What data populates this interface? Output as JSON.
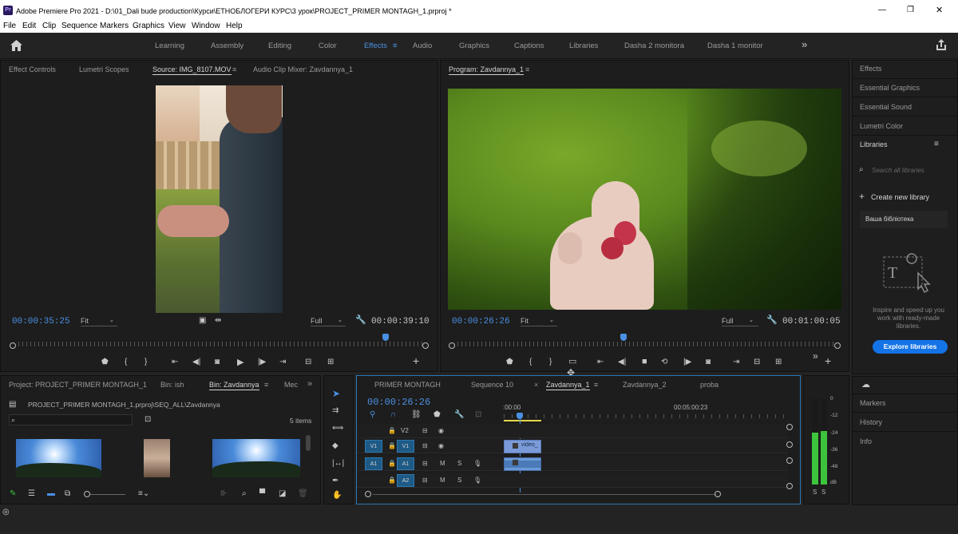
{
  "titlebar": {
    "app_badge": "Pr",
    "title": "Adobe Premiere Pro 2021 - D:\\01_Dali bude production\\Курси\\ЕТНОБЛОГЕРИ КУРС\\3 урок\\PROJECT_PRIMER MONTAGH_1.prproj *",
    "min": "—",
    "max": "❐",
    "close": "✕"
  },
  "menu": [
    "File",
    "Edit",
    "Clip",
    "Sequence",
    "Markers",
    "Graphics",
    "View",
    "Window",
    "Help"
  ],
  "workspaces": {
    "items": [
      "Learning",
      "Assembly",
      "Editing",
      "Color",
      "Effects",
      "Audio",
      "Graphics",
      "Captions",
      "Libraries",
      "Dasha 2 monitora",
      "Dasha 1 monitor"
    ],
    "active": "Effects",
    "active_menu": "≡",
    "more": "»"
  },
  "source_panel": {
    "tabs": [
      "Effect Controls",
      "Lumetri Scopes",
      "Source: IMG_8107.MOV",
      "Audio Clip Mixer: Zavdannya_1"
    ],
    "active_menu": "≡",
    "timecode": "00:00:35:25",
    "fit": "Fit",
    "full": "Full",
    "duration": "00:00:39:10",
    "playhead_fraction": 0.91
  },
  "program_panel": {
    "title": "Program: Zavdannya_1",
    "title_menu": "≡",
    "timecode": "00:00:26:26",
    "fit": "Fit",
    "full": "Full",
    "duration": "00:01:00:05",
    "playhead_fraction": 0.44
  },
  "right_panel": {
    "items": [
      "Effects",
      "Essential Graphics",
      "Essential Sound",
      "Lumetri Color",
      "Libraries"
    ],
    "libraries_menu": "≡",
    "search_placeholder": "Search all libraries",
    "create_library": "Create new library",
    "library_name": "Ваша бібліотека",
    "promo": "Inspire and speed up you work with ready-made libraries.",
    "explore": "Explore libraries",
    "bottom_items": [
      "Markers",
      "History",
      "Info"
    ]
  },
  "project_panel": {
    "tabs": [
      "Project: PROJECT_PRIMER MONTAGH_1",
      "Bin: ish",
      "Bin: Zavdannya",
      "Mec"
    ],
    "active_menu": "≡",
    "more": "»",
    "path": "PROJECT_PRIMER MONTAGH_1.prproj\\SEQ_ALL\\Zavdannya",
    "items_count": "5 items"
  },
  "timeline": {
    "tabs": [
      "PRIMER MONTAGH",
      "Sequence 10",
      "Zavdannya_1",
      "Zavdannya_2",
      "proba"
    ],
    "active_close": "×",
    "active_menu": "≡",
    "timecode": "00:00:26:26",
    "ruler_start": ":00:00",
    "ruler_mid": "00:05:00:23",
    "tracks": [
      {
        "target": "",
        "name": "V2",
        "type": "video"
      },
      {
        "target": "V1",
        "name": "V1",
        "type": "video"
      },
      {
        "target": "A1",
        "name": "A1",
        "type": "audio"
      },
      {
        "target": "",
        "name": "A2",
        "type": "audio"
      }
    ],
    "clip_label": "video_",
    "mute": "M",
    "solo": "S"
  },
  "meter": {
    "scale": [
      "0",
      "-12",
      "-24",
      "-36",
      "-48",
      "dB"
    ],
    "solo": [
      "S",
      "S"
    ],
    "left_level": 0.6,
    "right_level": 0.62
  },
  "colors": {
    "accent": "#4a90e2",
    "explore_button": "#1473e6",
    "timeline_border": "#2c78b2",
    "meter_green": "#3cc43c"
  }
}
